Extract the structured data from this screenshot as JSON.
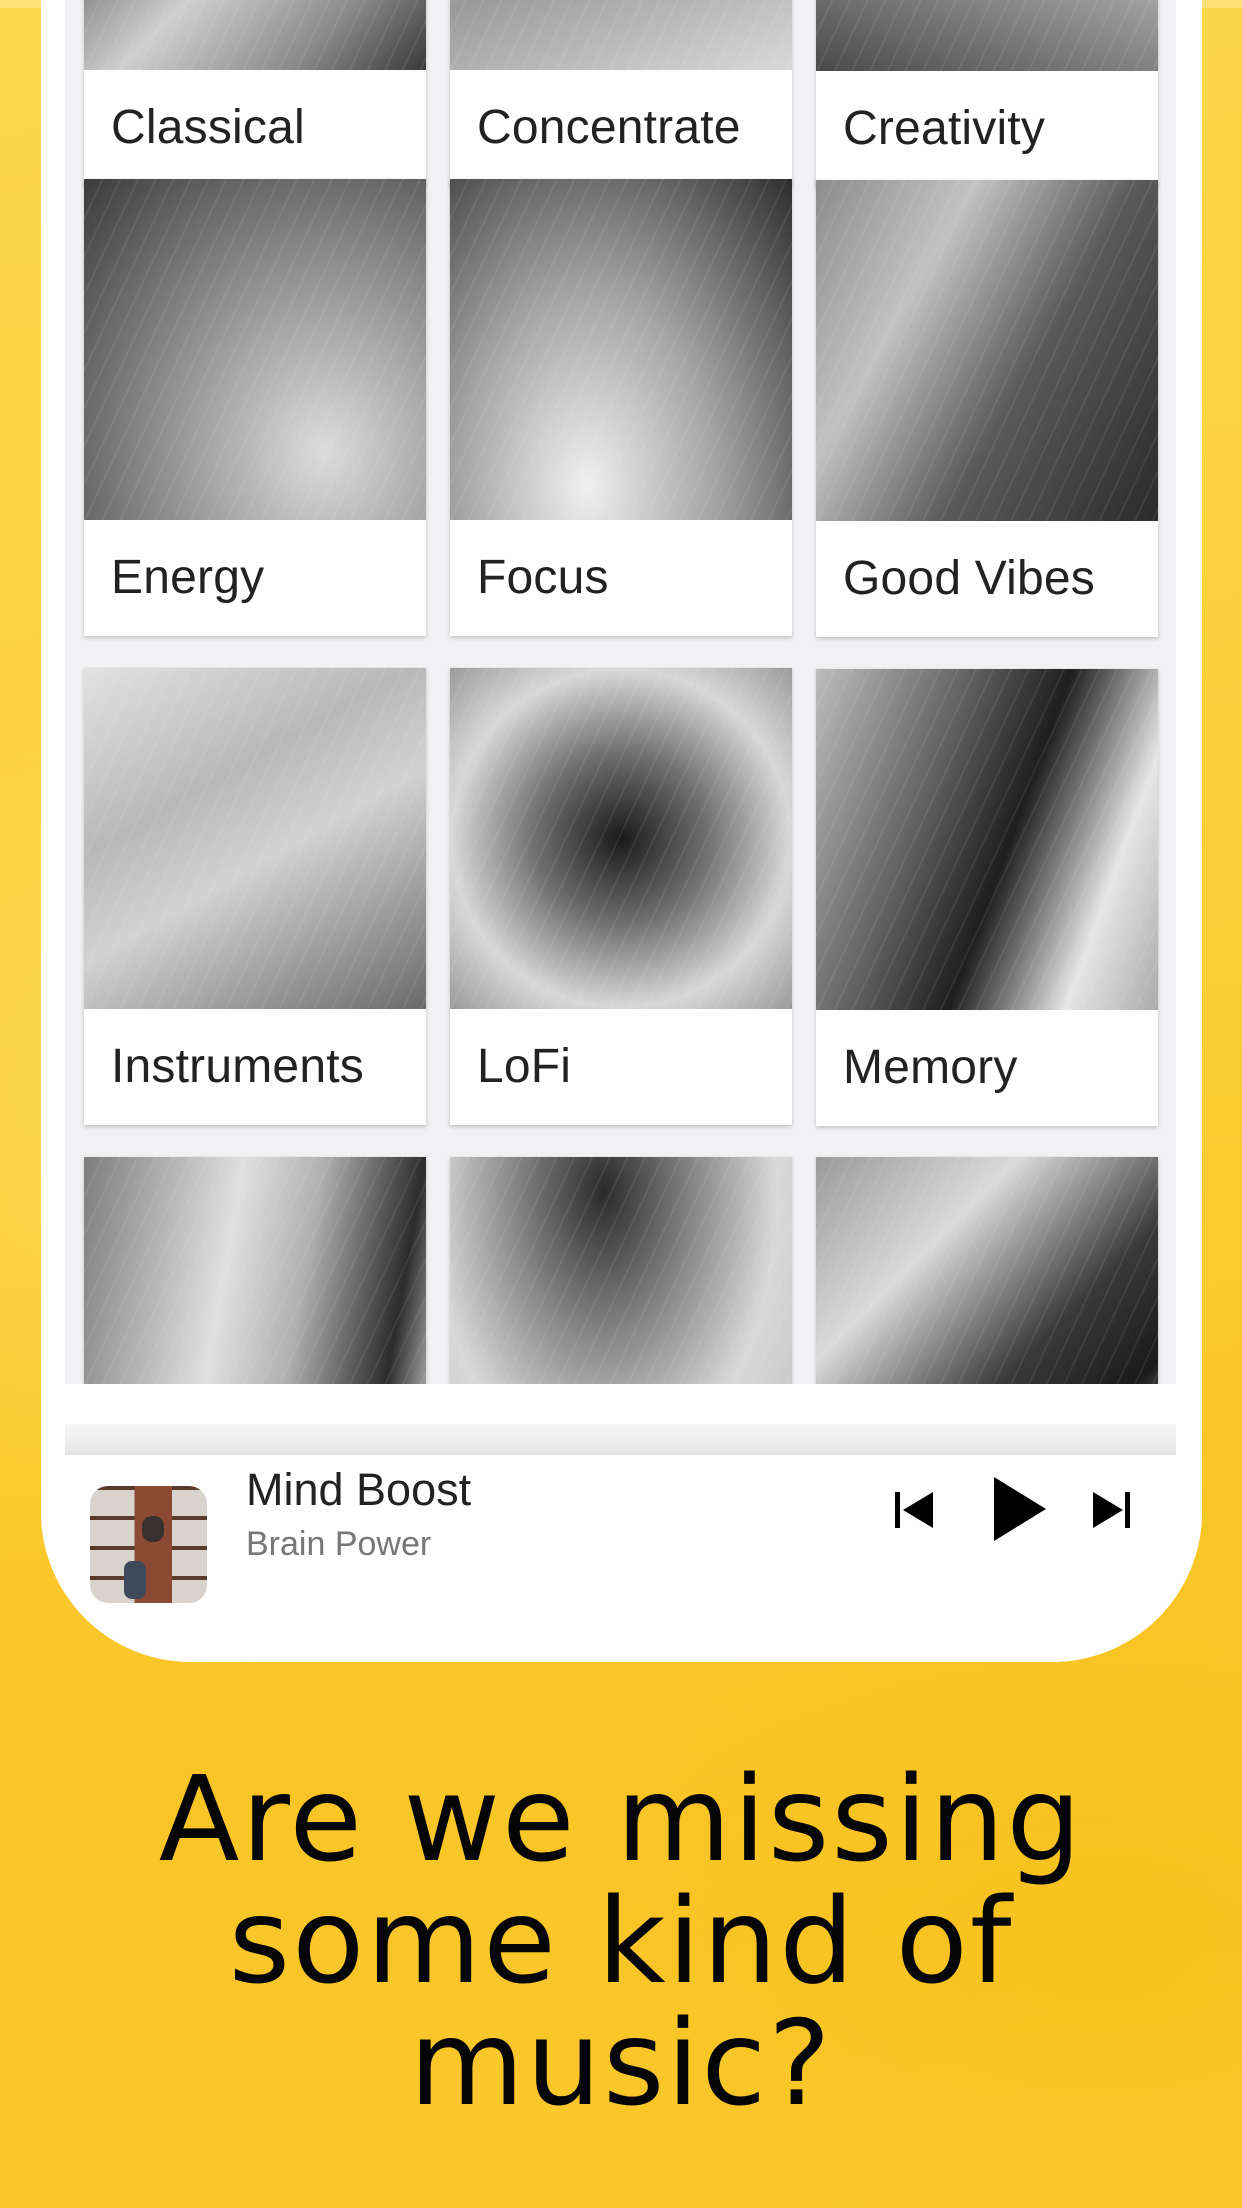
{
  "app": {
    "categories": [
      {
        "label": "Classical",
        "image": "photo-placeholder"
      },
      {
        "label": "Concentrate",
        "image": "photo-placeholder"
      },
      {
        "label": "Creativity",
        "image": "photo-placeholder"
      },
      {
        "label": "Energy",
        "image": "photo-placeholder"
      },
      {
        "label": "Focus",
        "image": "photo-placeholder"
      },
      {
        "label": "Good Vibes",
        "image": "photo-placeholder"
      },
      {
        "label": "Instruments",
        "image": "photo-placeholder"
      },
      {
        "label": "LoFi",
        "image": "photo-placeholder"
      },
      {
        "label": "Memory",
        "image": "photo-placeholder"
      },
      {
        "label": "",
        "image": "photo-placeholder"
      },
      {
        "label": "",
        "image": "photo-placeholder"
      },
      {
        "label": "",
        "image": "photo-placeholder"
      }
    ],
    "player": {
      "title": "Mind Boost",
      "subtitle": "Brain Power",
      "album_art": "bookshelf-photo",
      "controls": {
        "previous_icon": "skip-previous-icon",
        "play_icon": "play-icon",
        "next_icon": "skip-next-icon"
      }
    }
  },
  "promo": {
    "headline_lines": [
      "Are we missing",
      "some kind of",
      "music?"
    ]
  },
  "colors": {
    "background_yellow": "#FBCB33",
    "card_label_text": "#222222",
    "subtitle_text": "#777777",
    "list_background": "#F1F1F3"
  }
}
